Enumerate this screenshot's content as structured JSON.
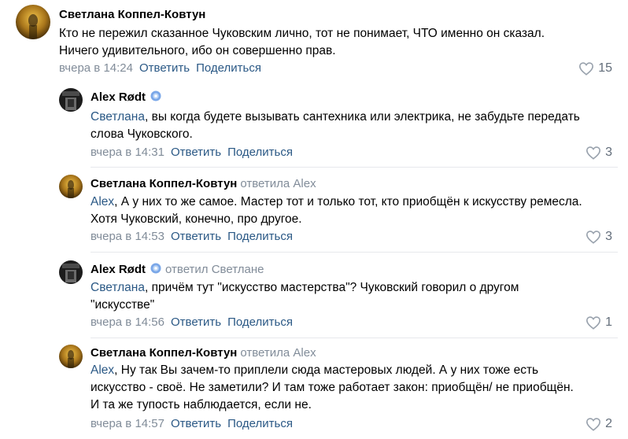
{
  "comments": [
    {
      "author": "Светлана Коппел-Ковтун",
      "reply_to": "",
      "mention": "",
      "lines": [
        "Кто не пережил сказанное Чуковским лично, тот не понимает, ЧТО именно он сказал.",
        "Ничего удивительного, ибо он совершенно прав."
      ],
      "time": "вчера в 14:24",
      "reply_label": "Ответить",
      "share_label": "Поделиться",
      "likes": "15"
    },
    {
      "author": "Alex Rødt",
      "reply_to": "",
      "mention": "Светлана",
      "lines": [
        ", вы когда будете вызывать сантехника или электрика, не забудьте передать",
        "слова Чуковского."
      ],
      "time": "вчера в 14:31",
      "reply_label": "Ответить",
      "share_label": "Поделиться",
      "likes": "3"
    },
    {
      "author": "Светлана Коппел-Ковтун",
      "reply_to": "ответила Alex",
      "mention": "Alex",
      "lines": [
        ", А у них то же самое. Мастер тот и только тот, кто приобщён к искусству ремесла.",
        "Хотя Чуковский, конечно, про другое."
      ],
      "time": "вчера в 14:53",
      "reply_label": "Ответить",
      "share_label": "Поделиться",
      "likes": "3"
    },
    {
      "author": "Alex Rødt",
      "reply_to": "ответил Светлане",
      "mention": "Светлана",
      "lines": [
        ", причём тут \"искусство мастерства\"? Чуковский говорил о другом",
        "\"искусстве\""
      ],
      "time": "вчера в 14:56",
      "reply_label": "Ответить",
      "share_label": "Поделиться",
      "likes": "1"
    },
    {
      "author": "Светлана Коппел-Ковтун",
      "reply_to": "ответила Alex",
      "mention": "Alex",
      "lines": [
        ", Ну так Вы зачем-то приплели сюда мастеровых людей. А у них тоже есть",
        "искусство - своё. Не заметили? И там тоже работает закон: приобщён/ не приобщён.",
        "И та же тупость наблюдается, если не."
      ],
      "time": "вчера в 14:57",
      "reply_label": "Ответить",
      "share_label": "Поделиться",
      "likes": "2"
    }
  ],
  "colors": {
    "link": "#2a5885",
    "muted": "#818c99",
    "text": "#000000"
  }
}
